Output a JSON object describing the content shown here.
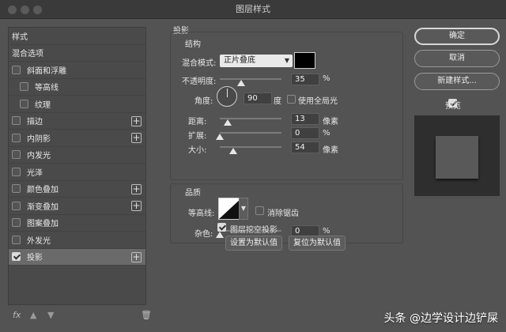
{
  "window": {
    "title": "图层样式"
  },
  "styles_panel": {
    "items": [
      {
        "label": "样式",
        "checkbox": false,
        "checked": false,
        "indent": 0,
        "plus": false,
        "selected": false
      },
      {
        "label": "混合选项",
        "checkbox": false,
        "checked": false,
        "indent": 0,
        "plus": false,
        "selected": false
      },
      {
        "label": "斜面和浮雕",
        "checkbox": true,
        "checked": false,
        "indent": 0,
        "plus": false,
        "selected": false
      },
      {
        "label": "等高线",
        "checkbox": true,
        "checked": false,
        "indent": 1,
        "plus": false,
        "selected": false
      },
      {
        "label": "纹理",
        "checkbox": true,
        "checked": false,
        "indent": 1,
        "plus": false,
        "selected": false
      },
      {
        "label": "描边",
        "checkbox": true,
        "checked": false,
        "indent": 0,
        "plus": true,
        "selected": false
      },
      {
        "label": "内阴影",
        "checkbox": true,
        "checked": false,
        "indent": 0,
        "plus": true,
        "selected": false
      },
      {
        "label": "内发光",
        "checkbox": true,
        "checked": false,
        "indent": 0,
        "plus": false,
        "selected": false
      },
      {
        "label": "光泽",
        "checkbox": true,
        "checked": false,
        "indent": 0,
        "plus": false,
        "selected": false
      },
      {
        "label": "颜色叠加",
        "checkbox": true,
        "checked": false,
        "indent": 0,
        "plus": true,
        "selected": false
      },
      {
        "label": "渐变叠加",
        "checkbox": true,
        "checked": false,
        "indent": 0,
        "plus": true,
        "selected": false
      },
      {
        "label": "图案叠加",
        "checkbox": true,
        "checked": false,
        "indent": 0,
        "plus": false,
        "selected": false
      },
      {
        "label": "外发光",
        "checkbox": true,
        "checked": false,
        "indent": 0,
        "plus": false,
        "selected": false
      },
      {
        "label": "投影",
        "checkbox": true,
        "checked": true,
        "indent": 0,
        "plus": true,
        "selected": true
      }
    ],
    "footer": {
      "fx": "fx",
      "up_icon": "arrow-up-icon",
      "down_icon": "arrow-down-icon",
      "trash_icon": "trash-icon"
    }
  },
  "drop_shadow": {
    "section_title": "投影",
    "structure": {
      "title": "结构",
      "blend_mode_label": "混合模式:",
      "blend_mode_value": "正片叠底",
      "blend_color": "#000000",
      "opacity_label": "不透明度:",
      "opacity_value": "35",
      "opacity_unit": "%",
      "angle_label": "角度:",
      "angle_value": "90",
      "angle_unit": "度",
      "global_light_label": "使用全局光",
      "global_light_checked": false,
      "distance_label": "距离:",
      "distance_value": "13",
      "distance_unit": "像素",
      "spread_label": "扩展:",
      "spread_value": "0",
      "spread_unit": "%",
      "size_label": "大小:",
      "size_value": "54",
      "size_unit": "像素"
    },
    "quality": {
      "title": "品质",
      "contour_label": "等高线:",
      "antialias_label": "消除锯齿",
      "antialias_checked": false,
      "noise_label": "杂色:",
      "noise_value": "0",
      "noise_unit": "%"
    },
    "knockout_label": "图层挖空投影",
    "knockout_checked": true,
    "set_default_label": "设置为默认值",
    "reset_default_label": "复位为默认值"
  },
  "actions": {
    "ok_label": "确定",
    "cancel_label": "取消",
    "new_style_label": "新建样式...",
    "preview_label": "预览",
    "preview_checked": true
  },
  "watermark": "头条 @边学设计边铲屎"
}
